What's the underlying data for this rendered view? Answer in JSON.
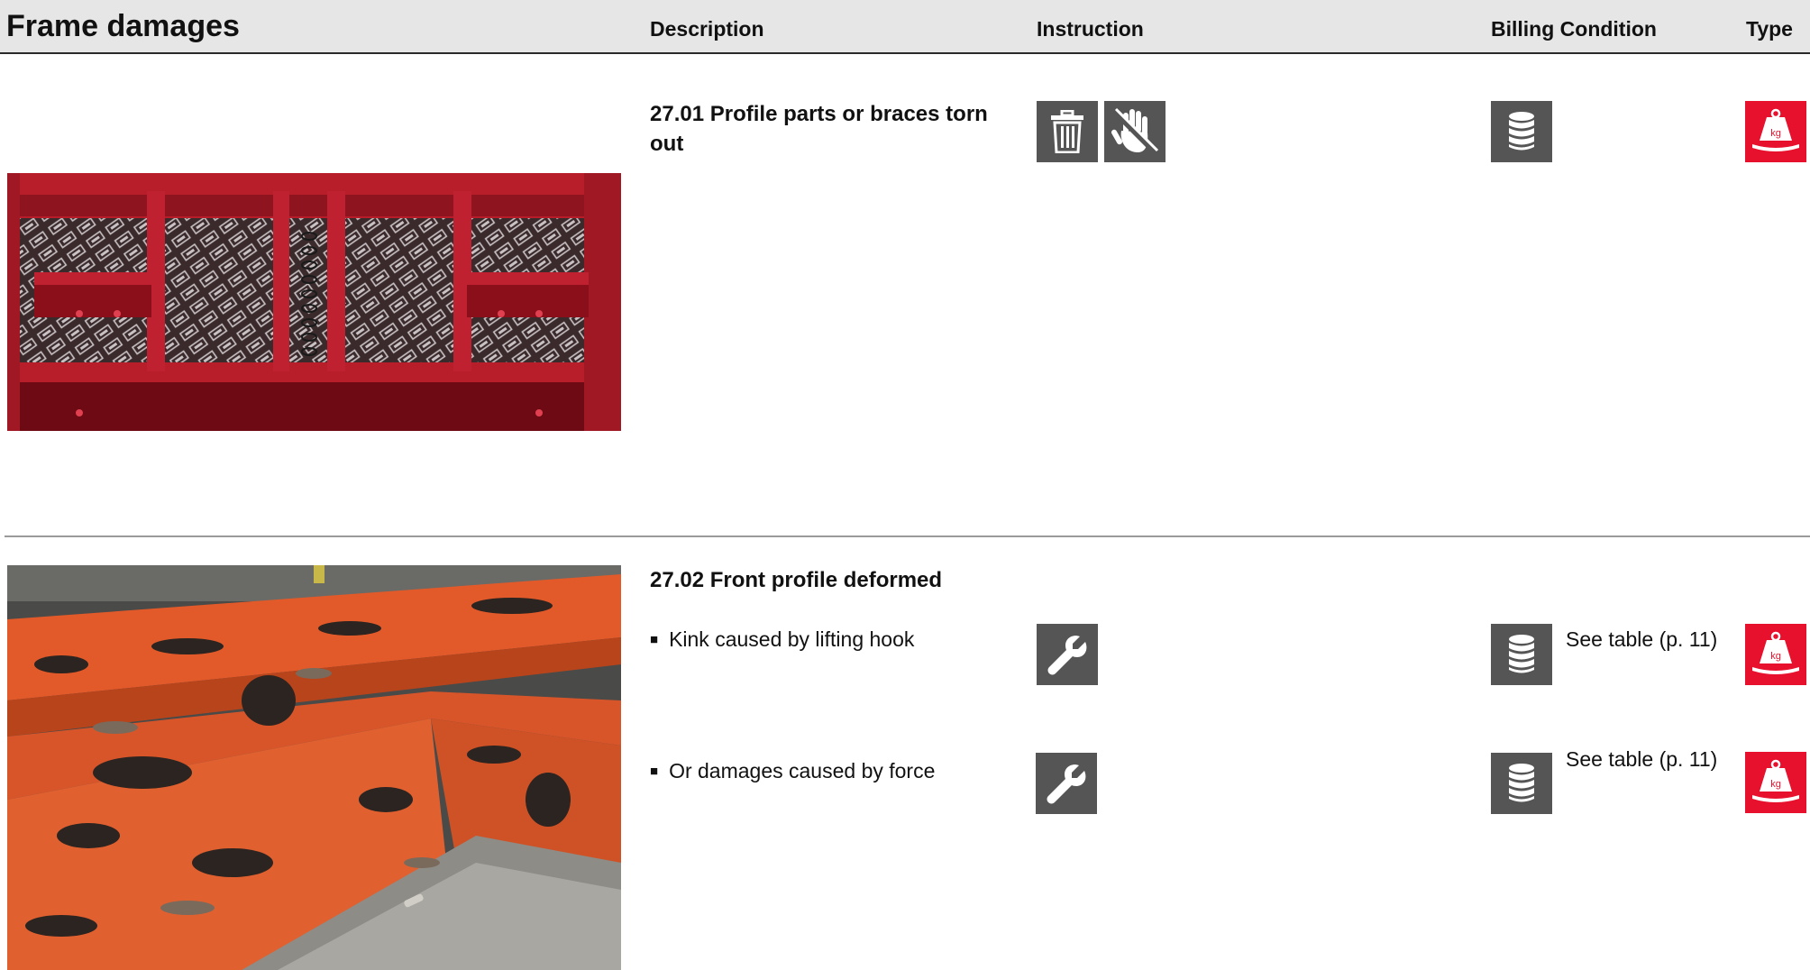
{
  "header": {
    "title": "Frame damages",
    "col_description": "Description",
    "col_instruction": "Instruction",
    "col_billing": "Billing Condition",
    "col_type": "Type"
  },
  "colors": {
    "header_bg": "#e6e6e6",
    "icon_gray": "#555555",
    "icon_red": "#e8112d"
  },
  "sections": [
    {
      "title": "27.01 Profile parts or braces torn out",
      "instruction_icons": [
        "trash-icon",
        "no-touch-hand-icon"
      ],
      "billing_icon": "coin-stack-icon",
      "type_icon": "weight-kg-icon"
    },
    {
      "title": "27.02 Front profile deformed",
      "items": [
        {
          "text": "Kink caused by lifting hook",
          "instruction_icon": "wrench-icon",
          "billing_icon": "coin-stack-icon",
          "billing_note": "See table (p. 11)",
          "type_icon": "weight-kg-icon"
        },
        {
          "text": "Or damages caused by force",
          "instruction_icon": "wrench-icon",
          "billing_icon": "coin-stack-icon",
          "billing_note": "See table (p. 11)",
          "type_icon": "weight-kg-icon"
        }
      ]
    }
  ],
  "bullet_glyph": "■"
}
